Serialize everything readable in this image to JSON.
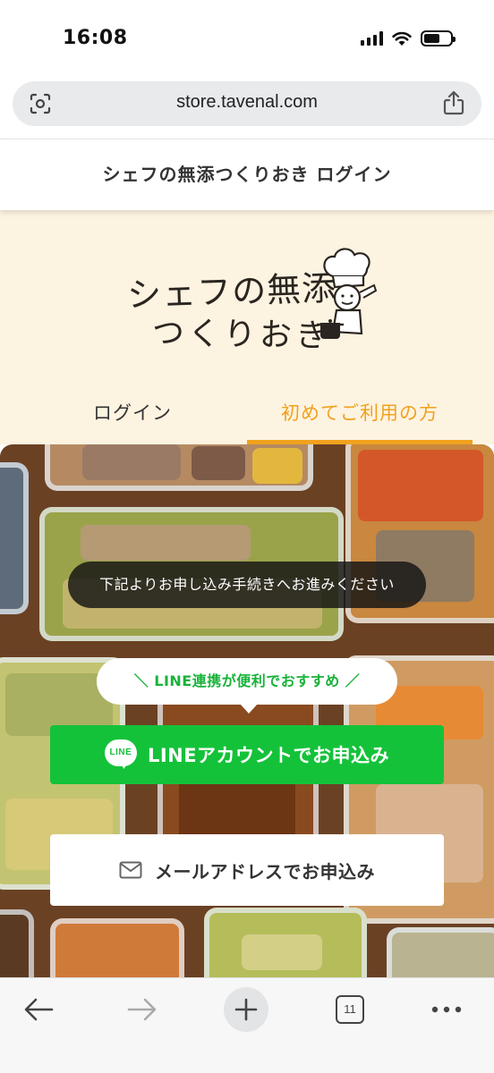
{
  "status_bar": {
    "time": "16:08"
  },
  "browser": {
    "url": "store.tavenal.com",
    "open_tabs_count": "11"
  },
  "header": {
    "title": "シェフの無添つくりおき ログイン"
  },
  "logo": {
    "line1": "シェフの無添",
    "line2": "つくりおき"
  },
  "tabs": [
    {
      "label": "ログイン",
      "active": false
    },
    {
      "label": "初めてご利用の方",
      "active": true
    }
  ],
  "main": {
    "notice": "下記よりお申し込み手続きへお進みください",
    "recommend_bubble": "＼ LINE連携が便利でおすすめ ／",
    "line_button_label": "LINEアカウントでお申込み",
    "line_icon_text": "LINE",
    "mail_button_label": "メールアドレスでお申込み"
  },
  "colors": {
    "accent_orange": "#f0a21e",
    "line_green": "#14c23a",
    "cream_bg": "#fdf3e1"
  },
  "icons": {
    "url_left": "lens-scan-icon",
    "url_right": "share-icon",
    "mail": "mail-icon",
    "toolbar": [
      "back-arrow-icon",
      "forward-arrow-icon",
      "plus-icon",
      "tabs-icon",
      "more-icon"
    ]
  }
}
